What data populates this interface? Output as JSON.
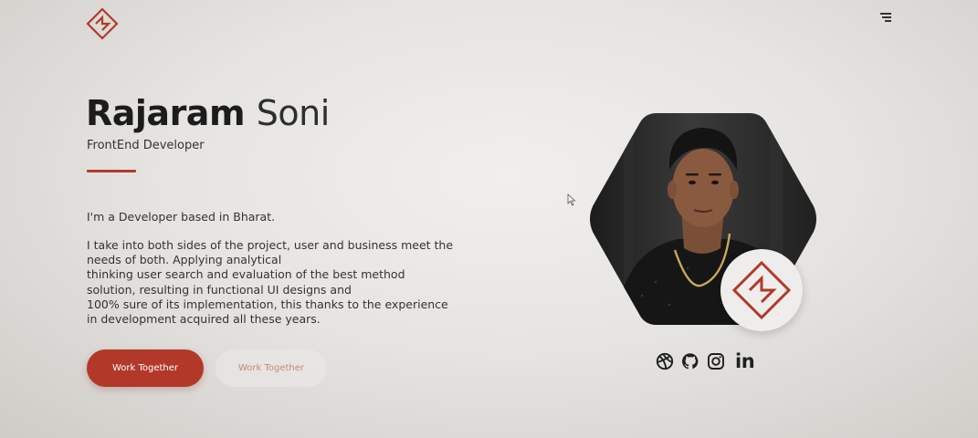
{
  "header": {
    "logo_icon": "fr-monogram-logo-icon",
    "menu_icon": "hamburger-menu-icon"
  },
  "hero": {
    "first_name": "Rajaram",
    "last_name": "Soni",
    "role": "FrontEnd Developer",
    "intro": "I'm a Developer based in Bharat.",
    "bio_lines": [
      "I take into both sides of the project, user and business meet the",
      "needs of both. Applying analytical",
      "thinking user search and evaluation of the best method",
      "solution, resulting in functional UI designs and",
      "100% sure of its implementation, this thanks to the experience",
      "in development acquired all these years."
    ],
    "primary_button": "Work Together",
    "secondary_button": "Work Together"
  },
  "profile": {
    "photo_icon": "profile-photo",
    "badge_icon": "fr-monogram-badge-icon"
  },
  "social": {
    "icons": [
      "dribbble-icon",
      "github-icon",
      "instagram-icon",
      "linkedin-icon"
    ],
    "linkedin_text": "in"
  },
  "colors": {
    "accent": "#b2392a",
    "text": "#2a2a2a",
    "background": "#e8e6e3"
  }
}
